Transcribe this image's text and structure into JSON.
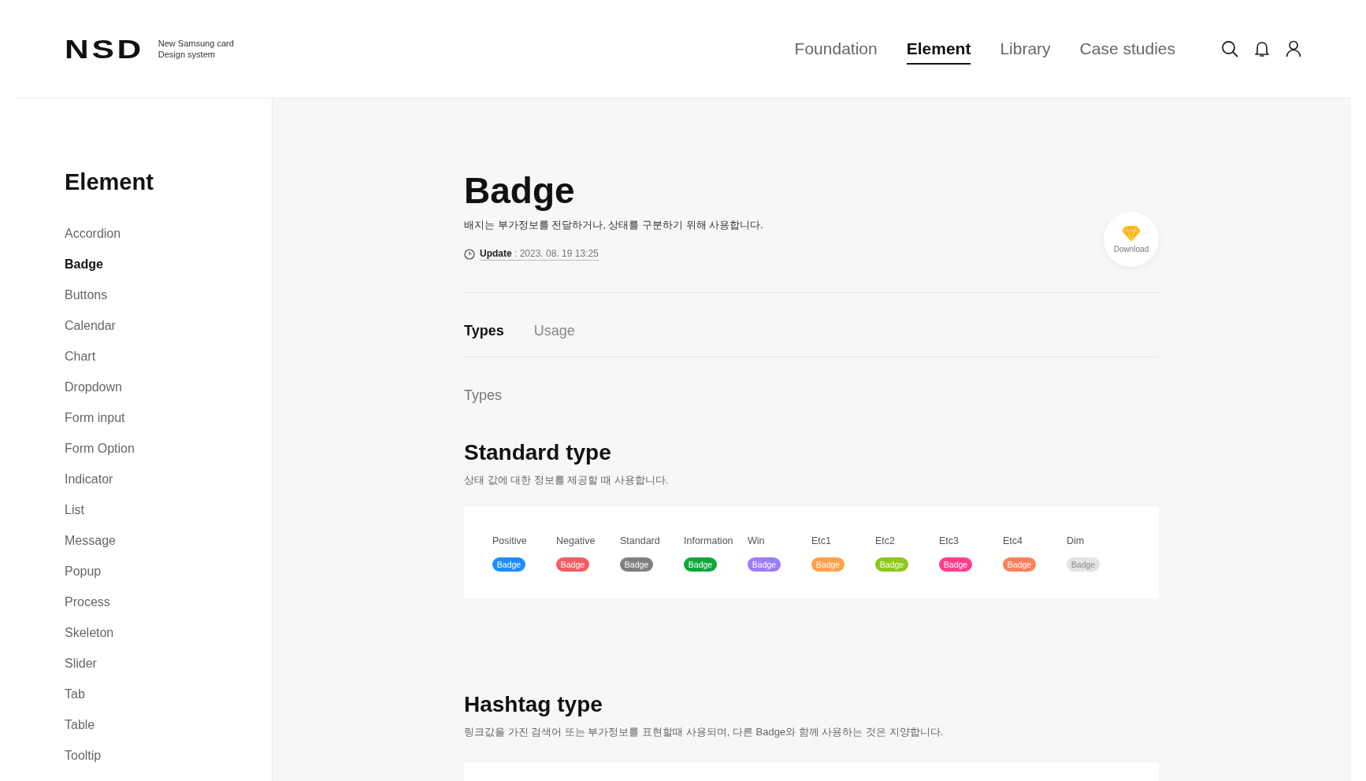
{
  "logo": {
    "mark": "NSD",
    "tagline_1": "New Samsung card",
    "tagline_2": "Design system"
  },
  "nav": [
    {
      "label": "Foundation",
      "selected": false
    },
    {
      "label": "Element",
      "selected": true
    },
    {
      "label": "Library",
      "selected": false
    },
    {
      "label": "Case studies",
      "selected": false
    }
  ],
  "sidebar": {
    "title": "Element",
    "items": [
      {
        "label": "Accordion",
        "selected": false
      },
      {
        "label": "Badge",
        "selected": true
      },
      {
        "label": "Buttons",
        "selected": false
      },
      {
        "label": "Calendar",
        "selected": false
      },
      {
        "label": "Chart",
        "selected": false
      },
      {
        "label": "Dropdown",
        "selected": false
      },
      {
        "label": "Form input",
        "selected": false
      },
      {
        "label": "Form Option",
        "selected": false
      },
      {
        "label": "Indicator",
        "selected": false
      },
      {
        "label": "List",
        "selected": false
      },
      {
        "label": "Message",
        "selected": false
      },
      {
        "label": "Popup",
        "selected": false
      },
      {
        "label": "Process",
        "selected": false
      },
      {
        "label": "Skeleton",
        "selected": false
      },
      {
        "label": "Slider",
        "selected": false
      },
      {
        "label": "Tab",
        "selected": false
      },
      {
        "label": "Table",
        "selected": false
      },
      {
        "label": "Tooltip",
        "selected": false
      }
    ]
  },
  "page": {
    "title": "Badge",
    "description": "배지는 부가정보를 전달하거나, 상태를 구분하기 위해 사용합니다.",
    "update_label": "Update",
    "update_value": " : 2023. 08. 19 13:25",
    "download": "Download"
  },
  "tabs": [
    {
      "label": "Types",
      "selected": true
    },
    {
      "label": "Usage",
      "selected": false
    }
  ],
  "section_label": "Types",
  "standard": {
    "title": "Standard type",
    "description": "상태 값에 대한 정보를 제공할 때 사용합니다.",
    "badges": [
      {
        "name": "Positive",
        "text": "Badge",
        "color": "#1e8cff"
      },
      {
        "name": "Negative",
        "text": "Badge",
        "color": "#f25c63"
      },
      {
        "name": "Standard",
        "text": "Badge",
        "color": "#808080"
      },
      {
        "name": "Information",
        "text": "Badge",
        "color": "#0fa83a"
      },
      {
        "name": "Win",
        "text": "Badge",
        "color": "#9b7cf8"
      },
      {
        "name": "Etc1",
        "text": "Badge",
        "color": "#ffa04a"
      },
      {
        "name": "Etc2",
        "text": "Badge",
        "color": "#8cc919"
      },
      {
        "name": "Etc3",
        "text": "Badge",
        "color": "#ff3d8b"
      },
      {
        "name": "Etc4",
        "text": "Badge",
        "color": "#ff7f5c"
      },
      {
        "name": "Dim",
        "text": "Badge",
        "color": "#e3e3e3"
      }
    ]
  },
  "hashtag": {
    "title": "Hashtag type",
    "description": "링크값을 가진 검색어 또는 부가정보를 표현할때 사용되며, 다른 Badge와 함께 사용하는 것은 지양합니다."
  }
}
